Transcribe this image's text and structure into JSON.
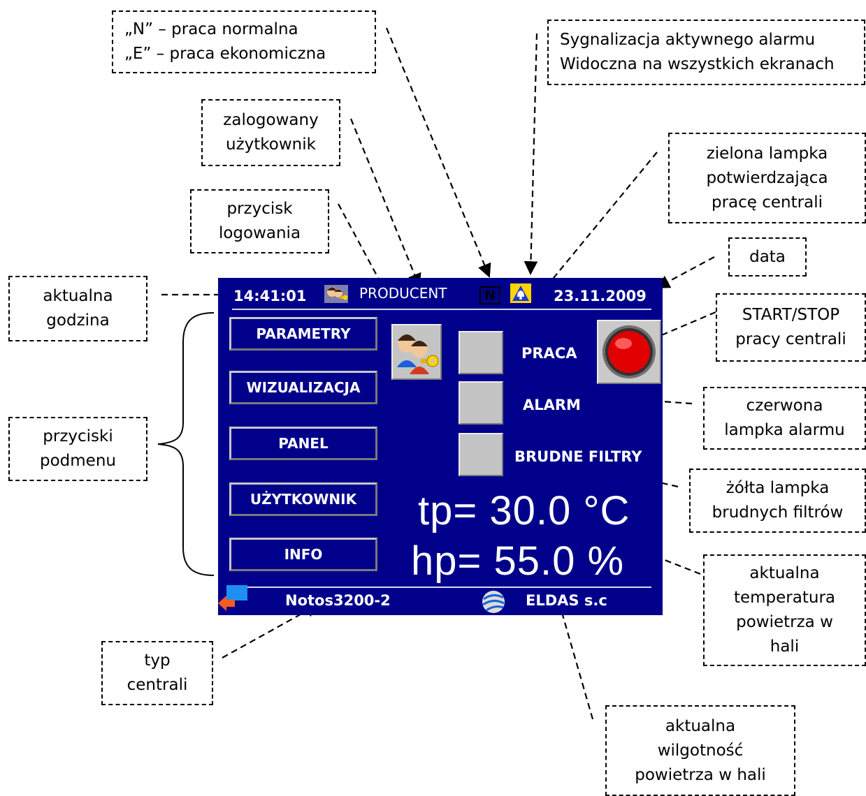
{
  "screen": {
    "time": "14:41:01",
    "user": "PRODUCENT",
    "mode": "N",
    "date": "23.11.2009",
    "menu": [
      "PARAMETRY",
      "WIZUALIZACJA",
      "PANEL",
      "UŻYTKOWNIK",
      "INFO"
    ],
    "lamps": [
      "PRACA",
      "ALARM",
      "BRUDNE FILTRY"
    ],
    "temperature": "tp= 30.0 °C",
    "humidity": "hp= 55.0 %",
    "model": "Notos3200-2",
    "company": "ELDAS s.c",
    "icons": [
      "user-key-icon",
      "alarm-bell-icon",
      "red-start-stop-button",
      "back-arrow-icon",
      "logo-globe-icon"
    ],
    "colors": {
      "background": "#00008b",
      "lamp": "#c4c4c4",
      "start_button": "#e00000"
    }
  },
  "callouts": {
    "mode": [
      "„N” – praca normalna",
      "„E” – praca ekonomiczna"
    ],
    "alarm_signal": [
      "Sygnalizacja aktywnego alarmu",
      "Widoczna na wszystkich ekranach"
    ],
    "logged_user": [
      "zalogowany",
      "użytkownik"
    ],
    "green_lamp": [
      "zielona lampka",
      "potwierdzająca",
      "pracę centrali"
    ],
    "login_button": [
      "przycisk",
      "logowania"
    ],
    "date": [
      "data"
    ],
    "current_time": [
      "aktualna",
      "godzina"
    ],
    "start_stop": [
      "START/STOP",
      "pracy centrali"
    ],
    "submenu_buttons": [
      "przyciski",
      "podmenu"
    ],
    "red_lamp": [
      "czerwona",
      "lampka alarmu"
    ],
    "yellow_lamp": [
      "żółta lampka",
      "brudnych filtrów"
    ],
    "temperature": [
      "aktualna",
      "temperatura",
      "powietrza w",
      "hali"
    ],
    "unit_type": [
      "typ",
      "centrali"
    ],
    "humidity": [
      "aktualna",
      "wilgotność",
      "powietrza w hali"
    ]
  }
}
